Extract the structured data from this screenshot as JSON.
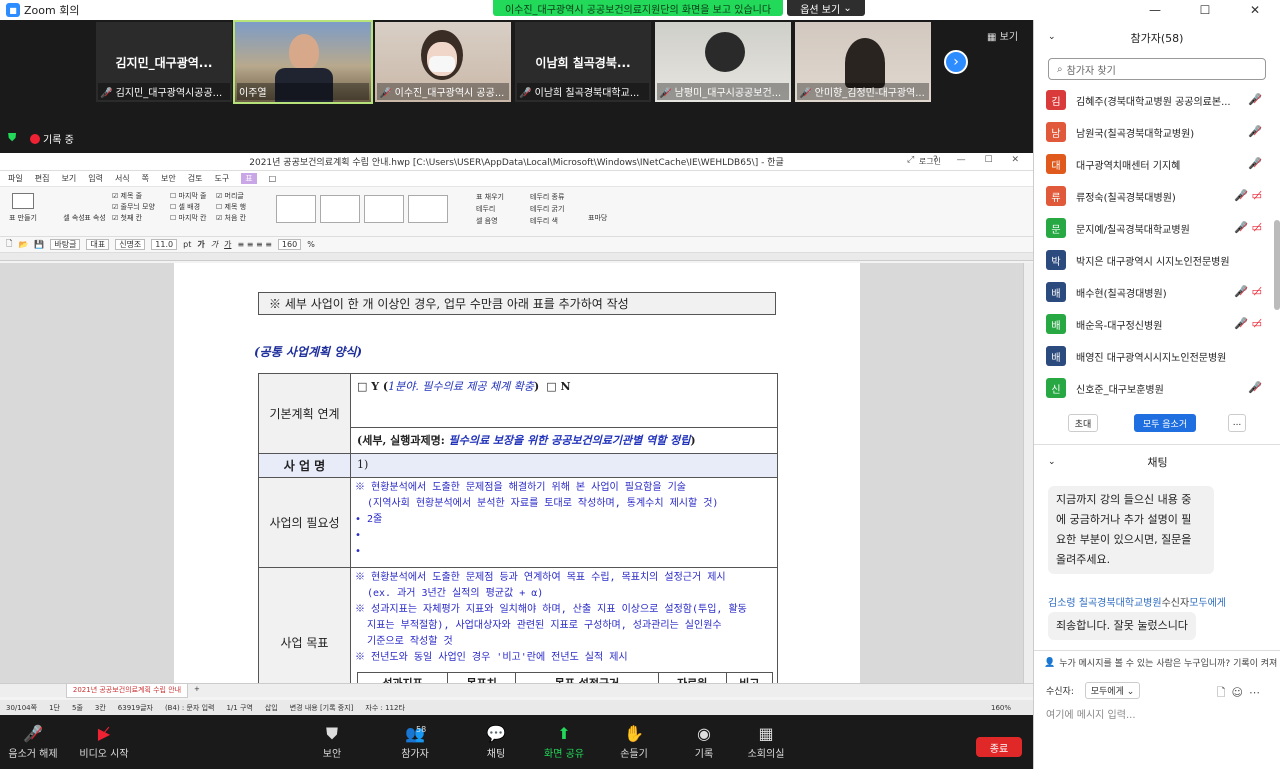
{
  "window": {
    "title": "Zoom 회의",
    "controls": [
      "—",
      "☐",
      "✕"
    ]
  },
  "banner": {
    "share_text": "이수진_대구광역시 공공보건의료지원단의 화면을 보고 있습니다",
    "view_option": "옵션 보기"
  },
  "gallery": {
    "tiles": [
      {
        "name": "김지민_대구광역...",
        "caption": "김지민_대구광역시공공...",
        "muted": true
      },
      {
        "name": "",
        "caption": "이주열",
        "muted": false,
        "active": true
      },
      {
        "name": "",
        "caption": "이수진_대구광역시 공공...",
        "muted": true
      },
      {
        "name": "이남희 칠곡경북...",
        "caption": "이남희 칠곡경북대학교...",
        "muted": true
      },
      {
        "name": "",
        "caption": "남평미_대구시공공보건...",
        "muted": true
      },
      {
        "name": "",
        "caption": "안미향_김정민-대구광역...",
        "muted": true
      }
    ],
    "view_label": "보기",
    "recording": "기록 중"
  },
  "doc_app": {
    "title": "2021년 공공보건의료계획 수립 안내.hwp [C:\\Users\\USER\\AppData\\Local\\Microsoft\\Windows\\INetCache\\IE\\WEHLDB65\\] - 한글",
    "login": "로그인",
    "menu": [
      "파일",
      "편집",
      "보기",
      "입력",
      "서식",
      "쪽",
      "보안",
      "검토",
      "도구",
      "표",
      "□"
    ],
    "ribbon": {
      "table_make": "표 만들기",
      "cell_props": "셀 속성",
      "cell_fmt": "표 속성",
      "checks1": [
        "제목 줄",
        "줄무늬 모양",
        "첫째 칸"
      ],
      "checks2": [
        "마지막 줄",
        "셀 배경",
        "마지막 칸"
      ],
      "checks3": [
        "머리글",
        "제목 행",
        "처음 칸"
      ],
      "checks4": [
        "마지막 칸",
        "처음 칸",
        "마지막 칸"
      ],
      "border_options": [
        "표 채우기",
        "테두리",
        "셀 음영"
      ],
      "border_opts2": [
        "테두리 종류",
        "테두리 굵기",
        "테두리 색"
      ],
      "formula": "표마당"
    },
    "format": {
      "style": "바탕글",
      "style2": "대표",
      "font": "신명조",
      "size": "11.0",
      "unit": "pt",
      "zoom": "160",
      "zoom_unit": "%"
    },
    "doc": {
      "note": "※ 세부 사업이 한 개 이상인 경우, 업무 수만큼 아래 표를 추가하여 작성",
      "form_title": "(공통 사업계획 양식)",
      "row1_label": "기본계획 연계",
      "row1_y": "□ Y (",
      "row1_area": "1분야. 필수의료 제공 체계 확충",
      "row1_close": ")",
      "row1_n": "□ N",
      "row1b_prefix": "(세부, 실행과제명: ",
      "row1b_task": "필수의료 보장을 위한 공공보건의료기관별 역할 정립",
      "row1b_close": ")",
      "row2_label": "사 업 명",
      "row2_value": "1)",
      "row3_label": "사업의 필요성",
      "row3_text": [
        "※ 현황분석에서 도출한 문제점을 해결하기 위해 본 사업이 필요함을 기술",
        "(지역사회 현황분석에서 분석한 자료를 토대로 작성하며, 통계수치 제시할 것)",
        "• 2줄",
        "•",
        "•"
      ],
      "row4_label": "사업 목표",
      "row4_text": [
        "※ 현황분석에서 도출한 문제점 등과 연계하여 목표 수립, 목표치의 설정근거 제시",
        "(ex. 과거 3년간 실적의 평균값 + α)",
        "※ 성과지표는 자체평가 지표와 일치해야 하며, 산출 지표 이상으로 설정함(투입, 활동",
        "지표는 부적절함), 사업대상자와 관련된 지표로 구성하며, 성과관리는 실인원수",
        "기준으로 작성할 것",
        "※ 전년도와 동일 사업인 경우 '비고'란에 전년도 실적 제시"
      ],
      "sub_headers": [
        "성과지표",
        "목표치",
        "목표 설정근거",
        "자료원",
        "비고"
      ]
    },
    "tab": "2021년 공공보건의료계획 수립 안내",
    "status": [
      "30/104쪽",
      "1단",
      "5줄",
      "3칸",
      "63919글자",
      "(B4) : 문자 입력",
      "1/1 구역",
      "삽입",
      "변경 내용 [기록 중지]",
      "자수 : 112타",
      "160%"
    ]
  },
  "toolbar": {
    "unmute": "음소거 해제",
    "video": "비디오 시작",
    "security": "보안",
    "participants": "참가자",
    "participants_count": "58",
    "chat": "채팅",
    "share": "화면 공유",
    "raise": "손들기",
    "record": "기록",
    "breakout": "소회의실",
    "end": "종료"
  },
  "participants_panel": {
    "title": "참가자(58)",
    "search_placeholder": "참가자 찾기",
    "list": [
      {
        "initial": "김",
        "name": "김혜주(경북대학교병원 공공의료본...",
        "color": "#d93a3a",
        "video_off": false
      },
      {
        "initial": "남",
        "name": "남원국(칠곡경북대학교병원)",
        "color": "#e0593a",
        "video_off": false
      },
      {
        "initial": "대",
        "name": "대구광역치매센터 기지혜",
        "color": "#e05a1e",
        "video_off": false
      },
      {
        "initial": "류",
        "name": "류정숙(칠곡경북대병원)",
        "color": "#e0593a",
        "video_off": true
      },
      {
        "initial": "문",
        "name": "문지예/칠곡경북대학교병원",
        "color": "#27a843",
        "video_off": true
      },
      {
        "initial": "박",
        "name": "박지은 대구광역시 시지노인전문병원",
        "color": "#2b4a7d",
        "video_off": false
      },
      {
        "initial": "배",
        "name": "배수현(칠곡경대병원)",
        "color": "#2b4a7d",
        "video_off": true
      },
      {
        "initial": "배",
        "name": "배순옥-대구정신병원",
        "color": "#27a843",
        "video_off": true
      },
      {
        "initial": "배",
        "name": "배영진 대구광역시시지노인전문병원",
        "color": "#2b4a7d",
        "video_off": false
      },
      {
        "initial": "신",
        "name": "신호준_대구보훈병원",
        "color": "#27a843",
        "video_off": false
      }
    ],
    "invite": "초대",
    "mute_all": "모두 음소거",
    "more": "..."
  },
  "chat_panel": {
    "title": "채팅",
    "message1": [
      "지금까지 강의 들으신 내용 중",
      "에 궁금하거나 추가 설명이 필",
      "요한 부분이 있으시면, 질문을",
      "올려주세요."
    ],
    "sender2": "김소령 칠곡경북대학교병원",
    "sender2_to": "수신자",
    "sender2_target": "모두에게",
    "message2": "죄송합니다. 잘못 눌렀스니다",
    "note": "누가 메시지를 볼 수 있는 사람은 누구입니까? 기록이 켜져",
    "recipient_label": "수신자:",
    "recipient_value": "모두에게",
    "input_placeholder": "여기에 메시지 입력..."
  }
}
